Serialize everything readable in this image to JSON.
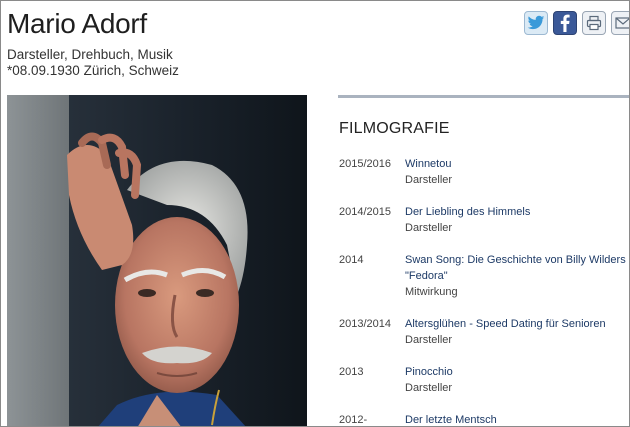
{
  "person": {
    "name": "Mario Adorf",
    "professions": "Darsteller, Drehbuch, Musik",
    "birth": "*08.09.1930 Zürich, Schweiz"
  },
  "share_icons": [
    "twitter-icon",
    "facebook-icon",
    "print-icon",
    "mail-icon"
  ],
  "colors": {
    "facebook": "#3b5998",
    "link": "#1d3a66",
    "divider": "#aab3bf"
  },
  "filmography": {
    "heading": "FILMOGRAFIE",
    "entries": [
      {
        "year": "2015/2016",
        "title": "Winnetou",
        "role": "Darsteller"
      },
      {
        "year": "2014/2015",
        "title": "Der Liebling des Himmels",
        "role": "Darsteller"
      },
      {
        "year": "2014",
        "title": "Swan Song: Die Geschichte von Billy Wilders \"Fedora\"",
        "role": "Mitwirkung"
      },
      {
        "year": "2013/2014",
        "title": "Altersglühen - Speed Dating für Senioren",
        "role": "Darsteller"
      },
      {
        "year": "2013",
        "title": "Pinocchio",
        "role": "Darsteller"
      },
      {
        "year": "2012-",
        "title": "Der letzte Mentsch",
        "role": ""
      }
    ]
  }
}
